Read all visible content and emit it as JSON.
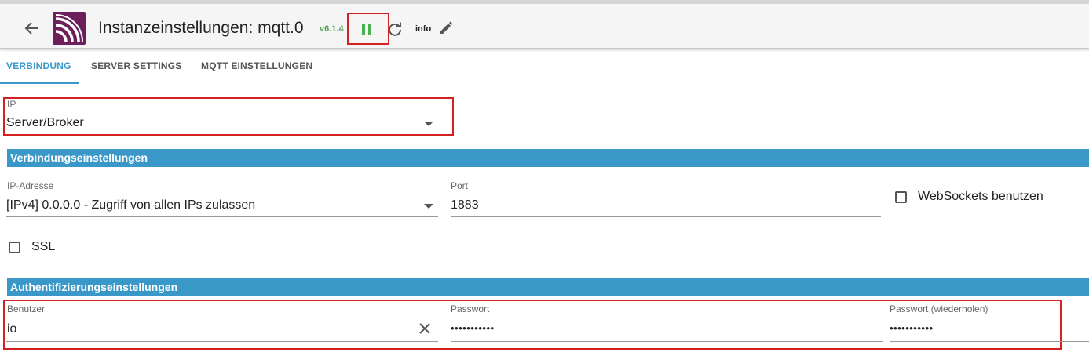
{
  "header": {
    "title": "Instanzeinstellungen: mqtt.0",
    "version": "v6.1.4",
    "info_label": "info",
    "icons": {
      "back": "arrow-left-icon",
      "logo": "mqtt-logo",
      "pause": "pause-icon",
      "reload": "reload-icon",
      "edit": "pencil-icon"
    }
  },
  "tabs": [
    {
      "label": "VERBINDUNG",
      "active": true
    },
    {
      "label": "SERVER SETTINGS",
      "active": false
    },
    {
      "label": "MQTT EINSTELLUNGEN",
      "active": false
    }
  ],
  "type_select": {
    "label": "IP",
    "value": "Server/Broker"
  },
  "connection": {
    "title": "Verbindungseinstellungen",
    "ip_label": "IP-Adresse",
    "ip_value": "[IPv4] 0.0.0.0 - Zugriff von allen IPs zulassen",
    "port_label": "Port",
    "port_value": "1883",
    "websockets_label": "WebSockets benutzen",
    "websockets_checked": false,
    "ssl_label": "SSL",
    "ssl_checked": false
  },
  "auth": {
    "title": "Authentifizierungseinstellungen",
    "user_label": "Benutzer",
    "user_value": "io",
    "password_label": "Passwort",
    "password_value": "•••••••••••",
    "password_repeat_label": "Passwort (wiederholen)",
    "password_repeat_value": "•••••••••••"
  },
  "colors": {
    "accent": "#3a98c9",
    "highlight": "#d42020",
    "version": "#5aa05a",
    "logo": "#6b1f5b"
  }
}
